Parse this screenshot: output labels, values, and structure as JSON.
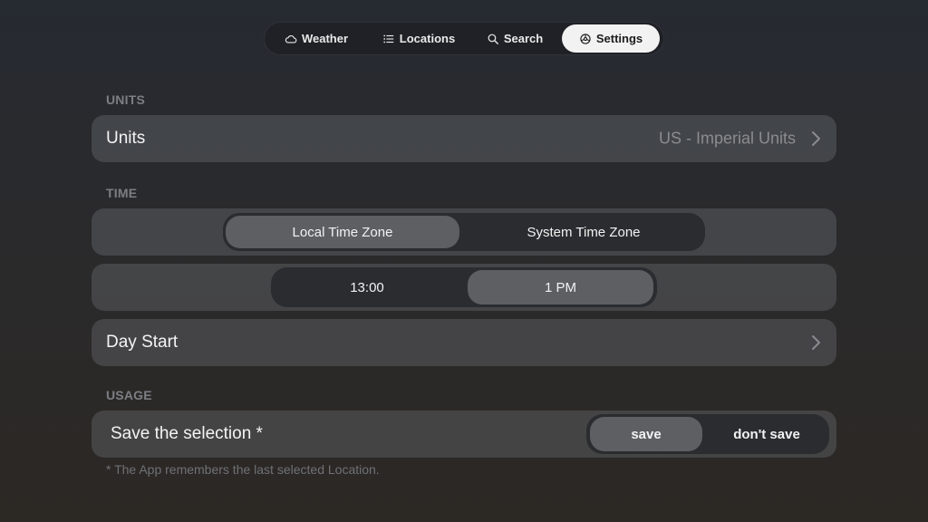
{
  "tabs": [
    {
      "label": "Weather",
      "icon": "cloud-icon"
    },
    {
      "label": "Locations",
      "icon": "list-icon"
    },
    {
      "label": "Search",
      "icon": "search-icon"
    },
    {
      "label": "Settings",
      "icon": "gear-icon",
      "active": true
    }
  ],
  "units": {
    "section_title": "UNITS",
    "label": "Units",
    "value": "US - Imperial Units"
  },
  "time": {
    "section_title": "TIME",
    "timezone_options": [
      "Local Time Zone",
      "System Time Zone"
    ],
    "timezone_selected": "Local Time Zone",
    "format_options": [
      "13:00",
      "1 PM"
    ],
    "format_selected": "1 PM",
    "day_start_label": "Day Start"
  },
  "usage": {
    "section_title": "USAGE",
    "label": "Save the selection *",
    "options": [
      "save",
      "don't save"
    ],
    "selected": "save",
    "footnote": "* The App remembers the last selected Location."
  },
  "colors": {
    "active_tab_bg": "#f2f2f2",
    "selected_segment_bg": "#5e5f63",
    "section_label": "#7c7e84"
  }
}
